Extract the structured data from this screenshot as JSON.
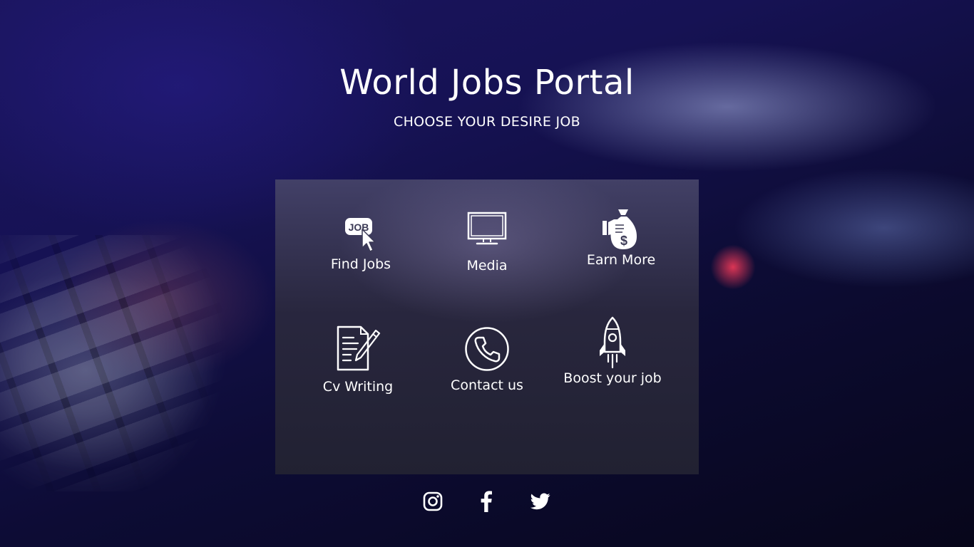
{
  "header": {
    "title": "World Jobs Portal",
    "subtitle": "CHOOSE YOUR DESIRE JOB"
  },
  "menu": {
    "items": [
      {
        "label": "Find Jobs",
        "icon": "job-cursor-icon",
        "badge": "JOB"
      },
      {
        "label": "Media",
        "icon": "monitor-icon"
      },
      {
        "label": "Earn More",
        "icon": "money-bag-hand-icon",
        "badge": "$"
      },
      {
        "label": "Cv Writing",
        "icon": "document-pen-icon"
      },
      {
        "label": "Contact us",
        "icon": "phone-icon"
      },
      {
        "label": "Boost your job",
        "icon": "rocket-icon"
      }
    ]
  },
  "social": [
    {
      "icon": "instagram-icon"
    },
    {
      "icon": "facebook-icon"
    },
    {
      "icon": "twitter-icon"
    }
  ],
  "colors": {
    "text": "#ffffff",
    "background_dark": "#0d0c35",
    "panel": "#2e2c44"
  }
}
